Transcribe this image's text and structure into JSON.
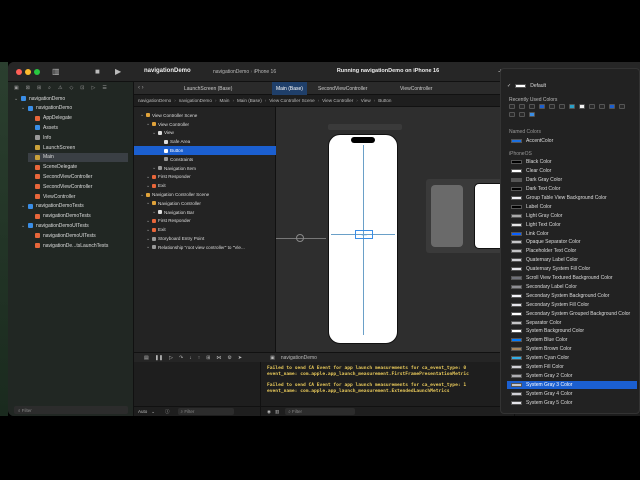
{
  "window": {
    "project_name": "navigationDemo",
    "scheme": "navigationDemo",
    "device": "iPhone 16",
    "status": "Running navigationDemo on iPhone 16"
  },
  "tabs": [
    {
      "label": "LaunchScreen (Base)",
      "active": false
    },
    {
      "label": "Main (Base)",
      "active": true
    },
    {
      "label": "SecondViewController",
      "active": false
    },
    {
      "label": "ViewController",
      "active": false
    }
  ],
  "jumpbar": [
    "navigationDemo",
    "navigationDemo",
    "Main",
    "Main (Base)",
    "View Controller Scene",
    "View Controller",
    "View",
    "Button"
  ],
  "navigator": {
    "items": [
      {
        "label": "navigationDemo",
        "indent": 0,
        "icon": "project-icon",
        "color": "#3a8ee6"
      },
      {
        "label": "navigationDemo",
        "indent": 1,
        "icon": "folder-icon",
        "color": "#3a8ee6"
      },
      {
        "label": "AppDelegate",
        "indent": 2,
        "icon": "swift-file-icon",
        "color": "#e8663a"
      },
      {
        "label": "Assets",
        "indent": 2,
        "icon": "assets-icon",
        "color": "#3a8ee6"
      },
      {
        "label": "Info",
        "indent": 2,
        "icon": "plist-icon",
        "color": "#999999"
      },
      {
        "label": "LaunchScreen",
        "indent": 2,
        "icon": "storyboard-icon",
        "color": "#c9a13a"
      },
      {
        "label": "Main",
        "indent": 2,
        "icon": "storyboard-icon",
        "color": "#c9a13a",
        "selected": true
      },
      {
        "label": "SceneDelegate",
        "indent": 2,
        "icon": "swift-file-icon",
        "color": "#e8663a"
      },
      {
        "label": "SecondViewController",
        "indent": 2,
        "icon": "swift-file-icon",
        "color": "#e8663a"
      },
      {
        "label": "SecondViewController",
        "indent": 2,
        "icon": "swift-file-icon",
        "color": "#e8663a"
      },
      {
        "label": "ViewController",
        "indent": 2,
        "icon": "swift-file-icon",
        "color": "#e8663a"
      },
      {
        "label": "navigationDemoTests",
        "indent": 1,
        "icon": "folder-icon",
        "color": "#3a8ee6"
      },
      {
        "label": "navigationDemoTests",
        "indent": 2,
        "icon": "swift-file-icon",
        "color": "#e8663a"
      },
      {
        "label": "navigationDemoUITests",
        "indent": 1,
        "icon": "folder-icon",
        "color": "#3a8ee6"
      },
      {
        "label": "navigationDemoUITests",
        "indent": 2,
        "icon": "swift-file-icon",
        "color": "#e8663a"
      },
      {
        "label": "navigationDe...tsLaunchTests",
        "indent": 2,
        "icon": "swift-file-icon",
        "color": "#e8663a"
      }
    ],
    "filter_placeholder": "Filter"
  },
  "outline": {
    "items": [
      {
        "label": "View Controller Scene",
        "indent": 0,
        "color": "#e0a23a"
      },
      {
        "label": "View Controller",
        "indent": 1,
        "color": "#e0a23a"
      },
      {
        "label": "View",
        "indent": 2,
        "color": "#dddddd"
      },
      {
        "label": "Safe Area",
        "indent": 3,
        "color": "#dddddd"
      },
      {
        "label": "Button",
        "indent": 3,
        "color": "#3a8ee6",
        "selected": true
      },
      {
        "label": "Constraints",
        "indent": 3,
        "color": "#999999"
      },
      {
        "label": "Navigation Item",
        "indent": 2,
        "color": "#999999"
      },
      {
        "label": "First Responder",
        "indent": 1,
        "color": "#e8663a"
      },
      {
        "label": "Exit",
        "indent": 1,
        "color": "#e8663a"
      },
      {
        "label": "Navigation Controller Scene",
        "indent": 0,
        "color": "#e0a23a"
      },
      {
        "label": "Navigation Controller",
        "indent": 1,
        "color": "#e0a23a"
      },
      {
        "label": "Navigation Bar",
        "indent": 2,
        "color": "#dddddd"
      },
      {
        "label": "First Responder",
        "indent": 1,
        "color": "#e8663a"
      },
      {
        "label": "Exit",
        "indent": 1,
        "color": "#e8663a"
      },
      {
        "label": "Storyboard Entry Point",
        "indent": 1,
        "color": "#999999"
      },
      {
        "label": "Relationship \"root view controller\" to \"Vie...",
        "indent": 1,
        "color": "#999999"
      }
    ],
    "filter_placeholder": "Filter"
  },
  "canvas": {
    "device_label": "iPhone 16",
    "zoom": "55%"
  },
  "debug": {
    "target": "navigationDemo",
    "auto_label": "Auto",
    "filter_placeholder": "Filter",
    "console_lines": [
      "Failed to send CA Event for app launch measurements for ca_event_type: 0",
      "event_name: com.apple.app_launch_measurement.FirstFramePresentationMetric",
      "Failed to send CA Event for app launch measurements for ca_event_type: 1",
      "event_name: com.apple.app_launch_measurement.ExtendedLaunchMetrics"
    ]
  },
  "color_picker": {
    "default_label": "Default",
    "recently_used_label": "Recently Used Colors",
    "recent_colors": [
      "#2a2a2a",
      "#2a2a2a",
      "#2a2a2a",
      "#1b5fd0",
      "#2a2a2a",
      "#2a2a2a",
      "#2aa0c8",
      "#f2f2f2",
      "#2a2a2a",
      "#2a2a2a",
      "#1b5fd0",
      "#2a2a2a",
      "#2a2a2a",
      "#2a2a2a",
      "#3a8ee6"
    ],
    "named_colors_label": "Named Colors",
    "named_colors": [
      {
        "label": "AccentColor",
        "color": "#1b6fe0"
      }
    ],
    "system_colors_label": "iPhoneOS",
    "system_colors": [
      {
        "label": "Black Color",
        "color": "#000000"
      },
      {
        "label": "Clear Color",
        "color": "#ffffff"
      },
      {
        "label": "Dark Gray Color",
        "color": "#555555"
      },
      {
        "label": "Dark Text Color",
        "color": "#000000"
      },
      {
        "label": "Group Table View Background Color",
        "color": "#efeff4"
      },
      {
        "label": "Label Color",
        "color": "#000000"
      },
      {
        "label": "Light Gray Color",
        "color": "#aaaaaa"
      },
      {
        "label": "Light Text Color",
        "color": "#e6e6e6"
      },
      {
        "label": "Link Color",
        "color": "#0a60ff"
      },
      {
        "label": "Opaque Separator Color",
        "color": "#c6c6c8"
      },
      {
        "label": "Placeholder Text Color",
        "color": "#c4c4c6"
      },
      {
        "label": "Quaternary Label Color",
        "color": "#d1d1d6"
      },
      {
        "label": "Quaternary System Fill Color",
        "color": "#e5e5ea"
      },
      {
        "label": "Scroll View Textured Background Color",
        "color": "#6f7179"
      },
      {
        "label": "Secondary Label Color",
        "color": "#8e8e93"
      },
      {
        "label": "Secondary System Background Color",
        "color": "#f2f2f7"
      },
      {
        "label": "Secondary System Fill Color",
        "color": "#e5e5ea"
      },
      {
        "label": "Secondary System Grouped Background Color",
        "color": "#ffffff"
      },
      {
        "label": "Separator Color",
        "color": "#c6c6c8"
      },
      {
        "label": "System Background Color",
        "color": "#ffffff"
      },
      {
        "label": "System Blue Color",
        "color": "#007aff"
      },
      {
        "label": "System Brown Color",
        "color": "#a2845e"
      },
      {
        "label": "System Cyan Color",
        "color": "#32ade6"
      },
      {
        "label": "System Fill Color",
        "color": "#d1d1d6"
      },
      {
        "label": "System Gray 2 Color",
        "color": "#aeaeb2"
      },
      {
        "label": "System Gray 3 Color",
        "color": "#c7c7cc",
        "selected": true
      },
      {
        "label": "System Gray 4 Color",
        "color": "#d1d1d6"
      },
      {
        "label": "System Gray 5 Color",
        "color": "#e5e5ea"
      }
    ]
  }
}
